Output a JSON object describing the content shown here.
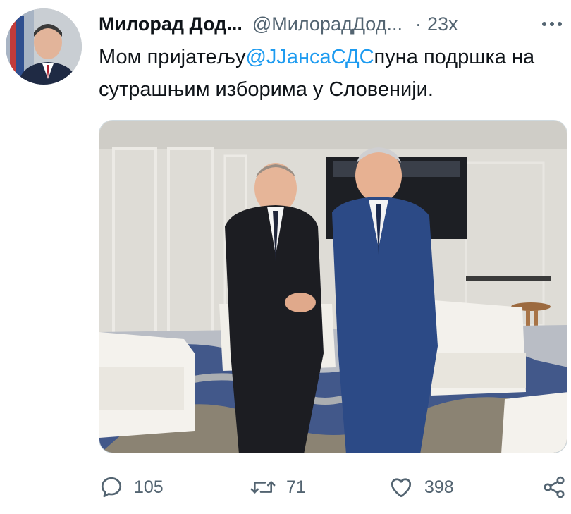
{
  "author": {
    "display_name": "Милорад Дод...",
    "handle": "@МилорадДод...",
    "separator": "·",
    "time": "23х"
  },
  "tweet": {
    "text_before": "Мом пријатељу",
    "mention": "@JJансаСДС",
    "text_after": "пуна подршка на сутрашњим изборима у Словенији."
  },
  "actions": {
    "replies": "105",
    "retweets": "71",
    "likes": "398"
  },
  "colors": {
    "accent": "#1d9bf0",
    "text_primary": "#0f1419",
    "text_secondary": "#536471"
  },
  "icons": [
    "avatar-photo",
    "more-icon",
    "reply-icon",
    "retweet-icon",
    "like-icon",
    "share-icon"
  ]
}
